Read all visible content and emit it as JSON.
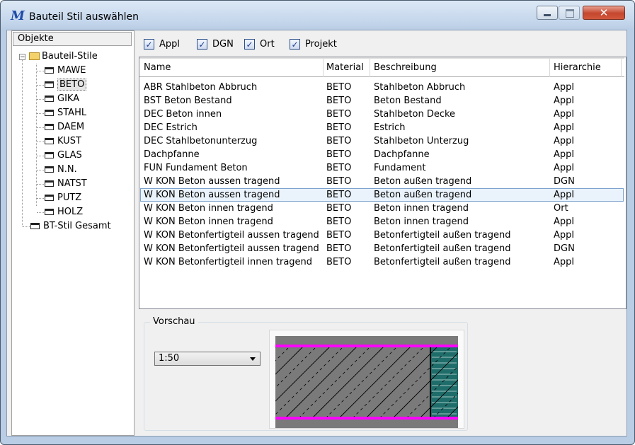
{
  "window": {
    "title": "Bauteil Stil auswählen",
    "app_icon_glyph": "M",
    "close_glyph": "✕"
  },
  "tree": {
    "header": "Objekte",
    "root": {
      "label": "Bauteil-Stile",
      "expander": "−"
    },
    "items": [
      "MAWE",
      "BETO",
      "GIKA",
      "STAHL",
      "DAEM",
      "KUST",
      "GLAS",
      "N.N.",
      "NATST",
      "PUTZ",
      "HOLZ"
    ],
    "selected_item": "BETO",
    "second_root": {
      "label": "BT-Stil Gesamt"
    }
  },
  "filters": [
    {
      "label": "Appl",
      "checked": true
    },
    {
      "label": "DGN",
      "checked": true
    },
    {
      "label": "Ort",
      "checked": true
    },
    {
      "label": "Projekt",
      "checked": true
    }
  ],
  "check_glyph": "✓",
  "table": {
    "columns": [
      "Name",
      "Material",
      "Beschreibung",
      "Hierarchie"
    ],
    "rows": [
      [
        "ABR Stahlbeton Abbruch",
        "BETO",
        "Stahlbeton Abbruch",
        "Appl"
      ],
      [
        "BST Beton Bestand",
        "BETO",
        "Beton Bestand",
        "Appl"
      ],
      [
        "DEC Beton innen",
        "BETO",
        "Stahlbeton Decke",
        "Appl"
      ],
      [
        "DEC Estrich",
        "BETO",
        "Estrich",
        "Appl"
      ],
      [
        "DEC Stahlbetonunterzug",
        "BETO",
        "Stahlbeton Unterzug",
        "Appl"
      ],
      [
        "Dachpfanne",
        "BETO",
        "Dachpfanne",
        "Appl"
      ],
      [
        "FUN Fundament Beton",
        "BETO",
        "Fundament",
        "Appl"
      ],
      [
        "W KON Beton aussen tragend",
        "BETO",
        "Beton außen tragend",
        "DGN"
      ],
      [
        "W KON Beton aussen tragend",
        "BETO",
        "Beton außen tragend",
        "Appl"
      ],
      [
        "W KON Beton innen tragend",
        "BETO",
        "Beton innen  tragend",
        "Ort"
      ],
      [
        "W KON Beton innen tragend",
        "BETO",
        "Beton innen  tragend",
        "Appl"
      ],
      [
        "W KON Betonfertigteil aussen tragend",
        "BETO",
        "Betonfertigteil außen tragend",
        "Appl"
      ],
      [
        "W KON Betonfertigteil aussen tragend",
        "BETO",
        "Betonfertigteil außen tragend",
        "DGN"
      ],
      [
        "W KON Betonfertigteil innen tragend",
        "BETO",
        "Betonfertigteil außen tragend",
        "Appl"
      ]
    ],
    "selected_row": 8
  },
  "preview": {
    "group_title": "Vorschau",
    "scale_value": "1:50",
    "colors": {
      "fill": "#7a7a7a",
      "edge_lines": "#ff00ff",
      "insulation": "#1f6d6a",
      "hatch": "#000000"
    }
  }
}
